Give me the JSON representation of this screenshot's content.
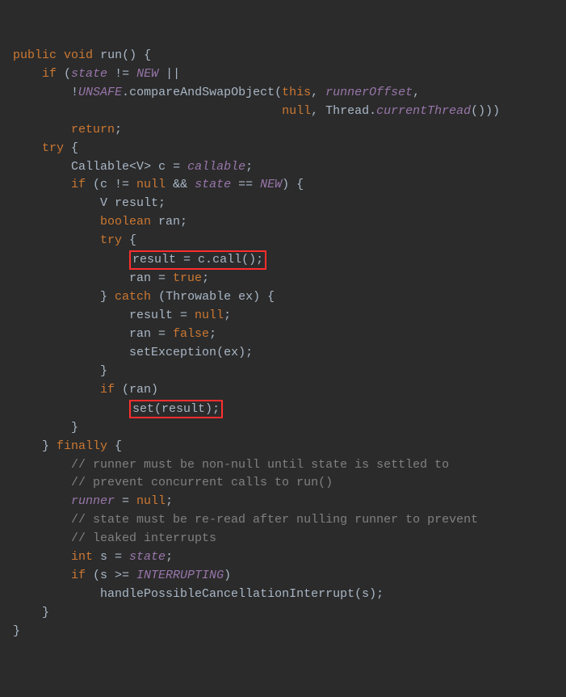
{
  "code": {
    "l0_pub": "public",
    "l0_void": "void",
    "l0_run": "run",
    "l0_paren": "()",
    "l0_brace": " {",
    "l1_if": "if",
    "l1_open": " (",
    "l1_state": "state",
    "l1_ne": " != ",
    "l1_new": "NEW",
    "l1_or": " ||",
    "l2_bang": "!",
    "l2_unsafe": "UNSAFE",
    "l2_dot1": ".",
    "l2_cas": "compareAndSwapObject",
    "l2_op": "(",
    "l2_this": "this",
    "l2_c1": ", ",
    "l2_ro": "runnerOffset",
    "l2_c2": ",",
    "l3_null": "null",
    "l3_c": ", ",
    "l3_thr": "Thread.",
    "l3_ct": "currentThread",
    "l3_end": "()))",
    "l4_ret": "return",
    "l4_sc": ";",
    "l5_try": "try",
    "l5_b": " {",
    "l6_cal": "Callable",
    "l6_lt": "<",
    "l6_v": "V",
    "l6_gt": ">",
    "l6_c": " c = ",
    "l6_call": "callable",
    "l6_sc": ";",
    "l7_if": "if",
    "l7_op": " (c != ",
    "l7_null": "null",
    "l7_amp": " && ",
    "l7_state": "state",
    "l7_eq": " == ",
    "l7_new": "NEW",
    "l7_cl": ") {",
    "l8_v": "V",
    "l8_res": " result;",
    "l9_bool": "boolean",
    "l9_ran": " ran;",
    "l10_try": "try",
    "l10_b": " {",
    "l11_res": "result = c.",
    "l11_call": "call",
    "l11_end": "();",
    "l12_ran": "ran = ",
    "l12_true": "true",
    "l12_sc": ";",
    "l13_cb": "}",
    "l13_catch": " catch ",
    "l13_op": "(Throwable ex) {",
    "l14_res": "result = ",
    "l14_null": "null",
    "l14_sc": ";",
    "l15_ran": "ran = ",
    "l15_false": "false",
    "l15_sc": ";",
    "l16_se": "setException",
    "l16_op": "(ex)",
    "l16_sc": ";",
    "l17_cb": "}",
    "l18_if": "if",
    "l18_op": " (ran)",
    "l19_set": "set",
    "l19_op": "(result)",
    "l19_sc": ";",
    "l20_cb": "}",
    "l21_cb": "}",
    "l21_fin": " finally ",
    "l21_ob": "{",
    "l22_c": "// runner must be non-null until state is settled to",
    "l23_c": "// prevent concurrent calls to run()",
    "l24_run": "runner",
    "l24_eq": " = ",
    "l24_null": "null",
    "l24_sc": ";",
    "l25_c": "// state must be re-read after nulling runner to prevent",
    "l26_c": "// leaked interrupts",
    "l27_int": "int",
    "l27_s": " s = ",
    "l27_state": "state",
    "l27_sc": ";",
    "l28_if": "if",
    "l28_op": " (s >= ",
    "l28_intr": "INTERRUPTING",
    "l28_cl": ")",
    "l29_h": "handlePossibleCancellationInterrupt",
    "l29_op": "(s)",
    "l29_sc": ";",
    "l30_cb": "}",
    "l31_cb": "}"
  }
}
